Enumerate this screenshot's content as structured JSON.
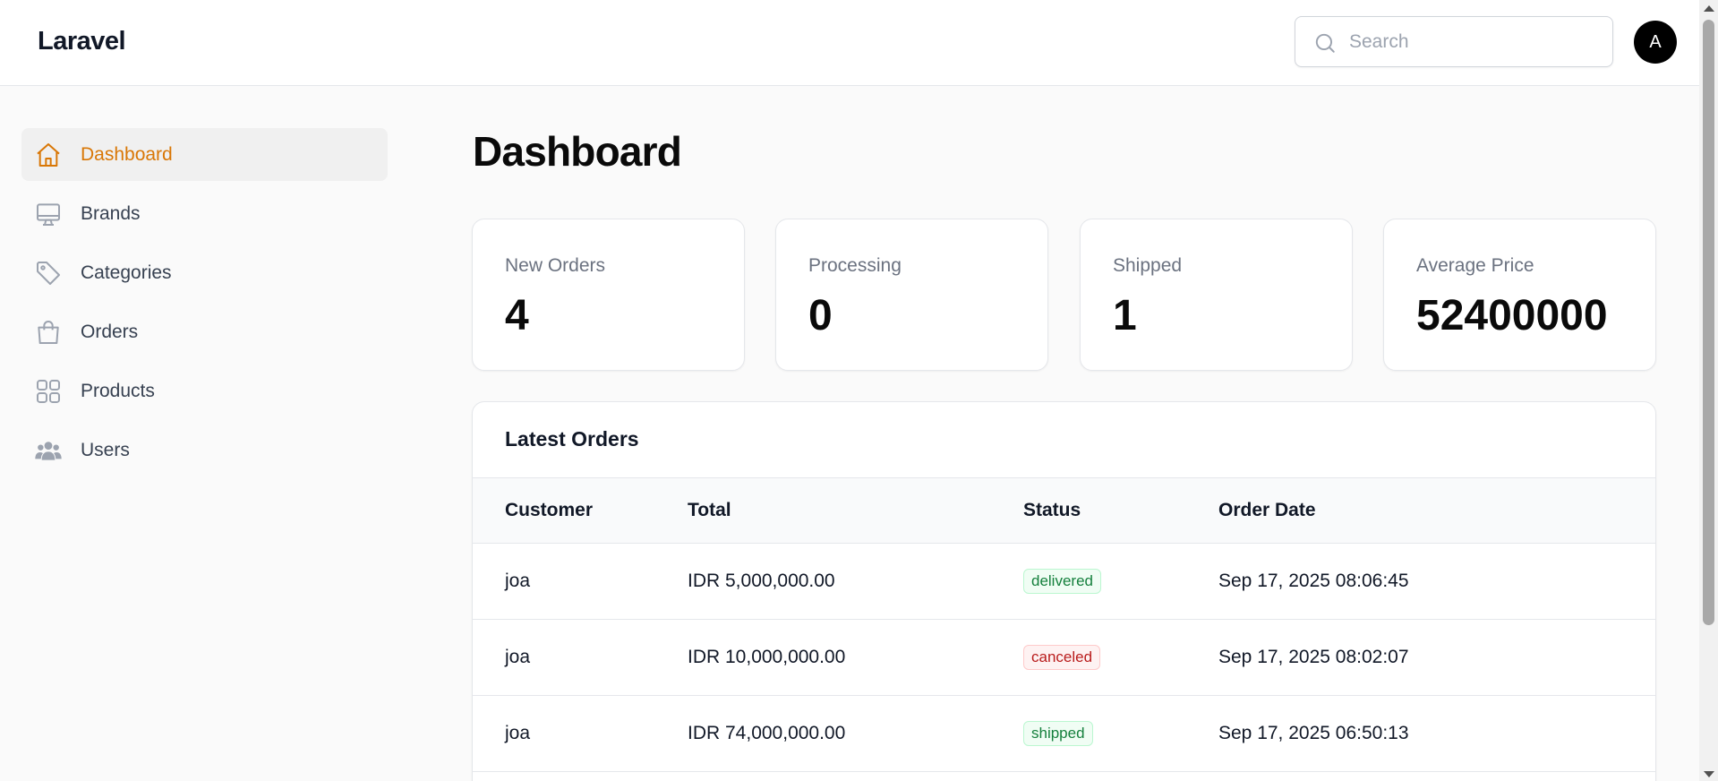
{
  "app": {
    "brand": "Laravel"
  },
  "header": {
    "search_placeholder": "Search",
    "avatar_initial": "A"
  },
  "sidebar": {
    "items": [
      {
        "label": "Dashboard",
        "icon": "home-icon",
        "active": true
      },
      {
        "label": "Brands",
        "icon": "monitor-icon",
        "active": false
      },
      {
        "label": "Categories",
        "icon": "tag-icon",
        "active": false
      },
      {
        "label": "Orders",
        "icon": "shopping-bag-icon",
        "active": false
      },
      {
        "label": "Products",
        "icon": "grid-icon",
        "active": false
      },
      {
        "label": "Users",
        "icon": "users-icon",
        "active": false
      }
    ]
  },
  "main": {
    "title": "Dashboard",
    "stats": [
      {
        "label": "New Orders",
        "value": "4"
      },
      {
        "label": "Processing",
        "value": "0"
      },
      {
        "label": "Shipped",
        "value": "1"
      },
      {
        "label": "Average Price",
        "value": "52400000"
      }
    ],
    "latest_orders": {
      "heading": "Latest Orders",
      "columns": [
        "Customer",
        "Total",
        "Status",
        "Order Date"
      ],
      "rows": [
        {
          "customer": "joa",
          "total": "IDR 5,000,000.00",
          "status": "delivered",
          "status_color": "success",
          "date": "Sep 17, 2025 08:06:45"
        },
        {
          "customer": "joa",
          "total": "IDR 10,000,000.00",
          "status": "canceled",
          "status_color": "danger",
          "date": "Sep 17, 2025 08:02:07"
        },
        {
          "customer": "joa",
          "total": "IDR 74,000,000.00",
          "status": "shipped",
          "status_color": "success",
          "date": "Sep 17, 2025 06:50:13"
        }
      ]
    }
  },
  "colors": {
    "accent": "#d97706",
    "success": "#15803d",
    "danger": "#b91c1c"
  }
}
